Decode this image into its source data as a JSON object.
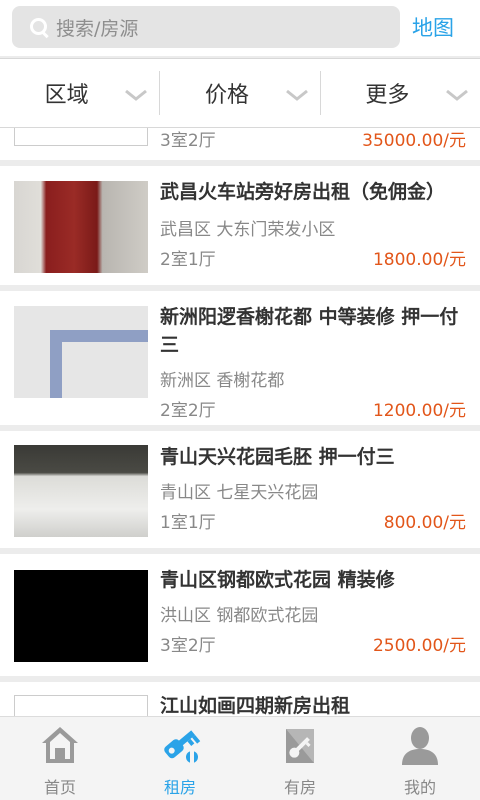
{
  "search": {
    "placeholder": "搜索/房源",
    "map_link": "地图"
  },
  "filters": [
    {
      "label": "区域"
    },
    {
      "label": "价格"
    },
    {
      "label": "更多"
    }
  ],
  "listings": [
    {
      "title": "",
      "location": "",
      "rooms": "3室2厅",
      "price": "35000.00/元"
    },
    {
      "title": "武昌火车站旁好房出租（免佣金）",
      "location": "武昌区 大东门荣发小区",
      "rooms": "2室1厅",
      "price": "1800.00/元"
    },
    {
      "title": "新洲阳逻香榭花都 中等装修 押一付三",
      "location": "新洲区 香榭花都",
      "rooms": "2室2厅",
      "price": "1200.00/元"
    },
    {
      "title": "青山天兴花园毛胚 押一付三",
      "location": "青山区 七星天兴花园",
      "rooms": "1室1厅",
      "price": "800.00/元"
    },
    {
      "title": "青山区钢都欧式花园 精装修",
      "location": "洪山区 钢都欧式花园",
      "rooms": "3室2厅",
      "price": "2500.00/元"
    },
    {
      "title": "江山如画四期新房出租",
      "location": "",
      "rooms": "",
      "price": ""
    }
  ],
  "nav": [
    {
      "label": "首页",
      "icon": "home-icon"
    },
    {
      "label": "租房",
      "icon": "key-icon",
      "active": true
    },
    {
      "label": "有房",
      "icon": "house-key-icon"
    },
    {
      "label": "我的",
      "icon": "user-icon"
    }
  ],
  "colors": {
    "accent": "#2aa3e8",
    "price": "#e2561a"
  }
}
